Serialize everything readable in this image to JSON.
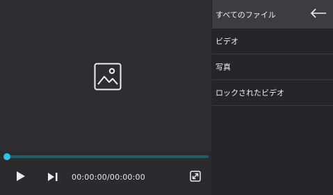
{
  "player": {
    "time_display": "00:00:00/00:00:00",
    "progress_fraction": 0,
    "accent_color": "#29c6e8",
    "placeholder_icon": "image-icon",
    "play_icon": "play-icon",
    "next_icon": "skip-next-icon",
    "fullscreen_icon": "fullscreen-icon"
  },
  "sidebar": {
    "header_label": "すべてのファイル",
    "back_icon": "arrow-left-icon",
    "items": [
      {
        "label": "ビデオ"
      },
      {
        "label": "写真"
      },
      {
        "label": "ロックされたビデオ"
      }
    ]
  }
}
